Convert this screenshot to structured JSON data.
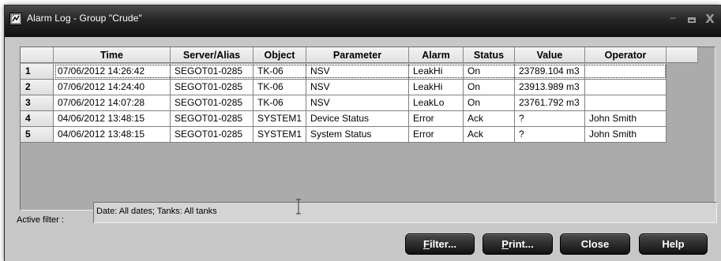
{
  "window": {
    "title": "Alarm Log - Group \"Crude\"",
    "icon": "alarm-log-app-icon"
  },
  "grid": {
    "columns": [
      {
        "key": "rownum",
        "label": ""
      },
      {
        "key": "time",
        "label": "Time"
      },
      {
        "key": "server",
        "label": "Server/Alias"
      },
      {
        "key": "object",
        "label": "Object"
      },
      {
        "key": "parameter",
        "label": "Parameter"
      },
      {
        "key": "alarm",
        "label": "Alarm"
      },
      {
        "key": "status",
        "label": "Status"
      },
      {
        "key": "value",
        "label": "Value"
      },
      {
        "key": "operator",
        "label": "Operator"
      }
    ],
    "rows": [
      {
        "rownum": "1",
        "time": "07/06/2012 14:26:42",
        "server": "SEGOT01-0285",
        "object": "TK-06",
        "parameter": "NSV",
        "alarm": "LeakHi",
        "status": "On",
        "value": "23789.104 m3",
        "operator": ""
      },
      {
        "rownum": "2",
        "time": "07/06/2012 14:24:40",
        "server": "SEGOT01-0285",
        "object": "TK-06",
        "parameter": "NSV",
        "alarm": "LeakHi",
        "status": "On",
        "value": "23913.989 m3",
        "operator": ""
      },
      {
        "rownum": "3",
        "time": "07/06/2012 14:07:28",
        "server": "SEGOT01-0285",
        "object": "TK-06",
        "parameter": "NSV",
        "alarm": "LeakLo",
        "status": "On",
        "value": "23761.792 m3",
        "operator": ""
      },
      {
        "rownum": "4",
        "time": "04/06/2012 13:48:15",
        "server": "SEGOT01-0285",
        "object": "SYSTEM1",
        "parameter": "Device Status",
        "alarm": "Error",
        "status": "Ack",
        "value": "?",
        "operator": "John Smith"
      },
      {
        "rownum": "5",
        "time": "04/06/2012 13:48:15",
        "server": "SEGOT01-0285",
        "object": "SYSTEM1",
        "parameter": "System Status",
        "alarm": "Error",
        "status": "Ack",
        "value": "?",
        "operator": "John Smith"
      }
    ]
  },
  "filter": {
    "label": "Active filter :",
    "value": "Date: All dates; Tanks: All tanks"
  },
  "buttons": {
    "filter_mnemonic": "F",
    "filter_rest": "ilter...",
    "print_mnemonic": "P",
    "print_rest": "rint...",
    "close": "Close",
    "help": "Help"
  },
  "colors": {
    "titlebar": "#1a1a1a",
    "window_bg": "#c7c7c7",
    "grid_bg": "#ababab",
    "button": "#222222"
  }
}
